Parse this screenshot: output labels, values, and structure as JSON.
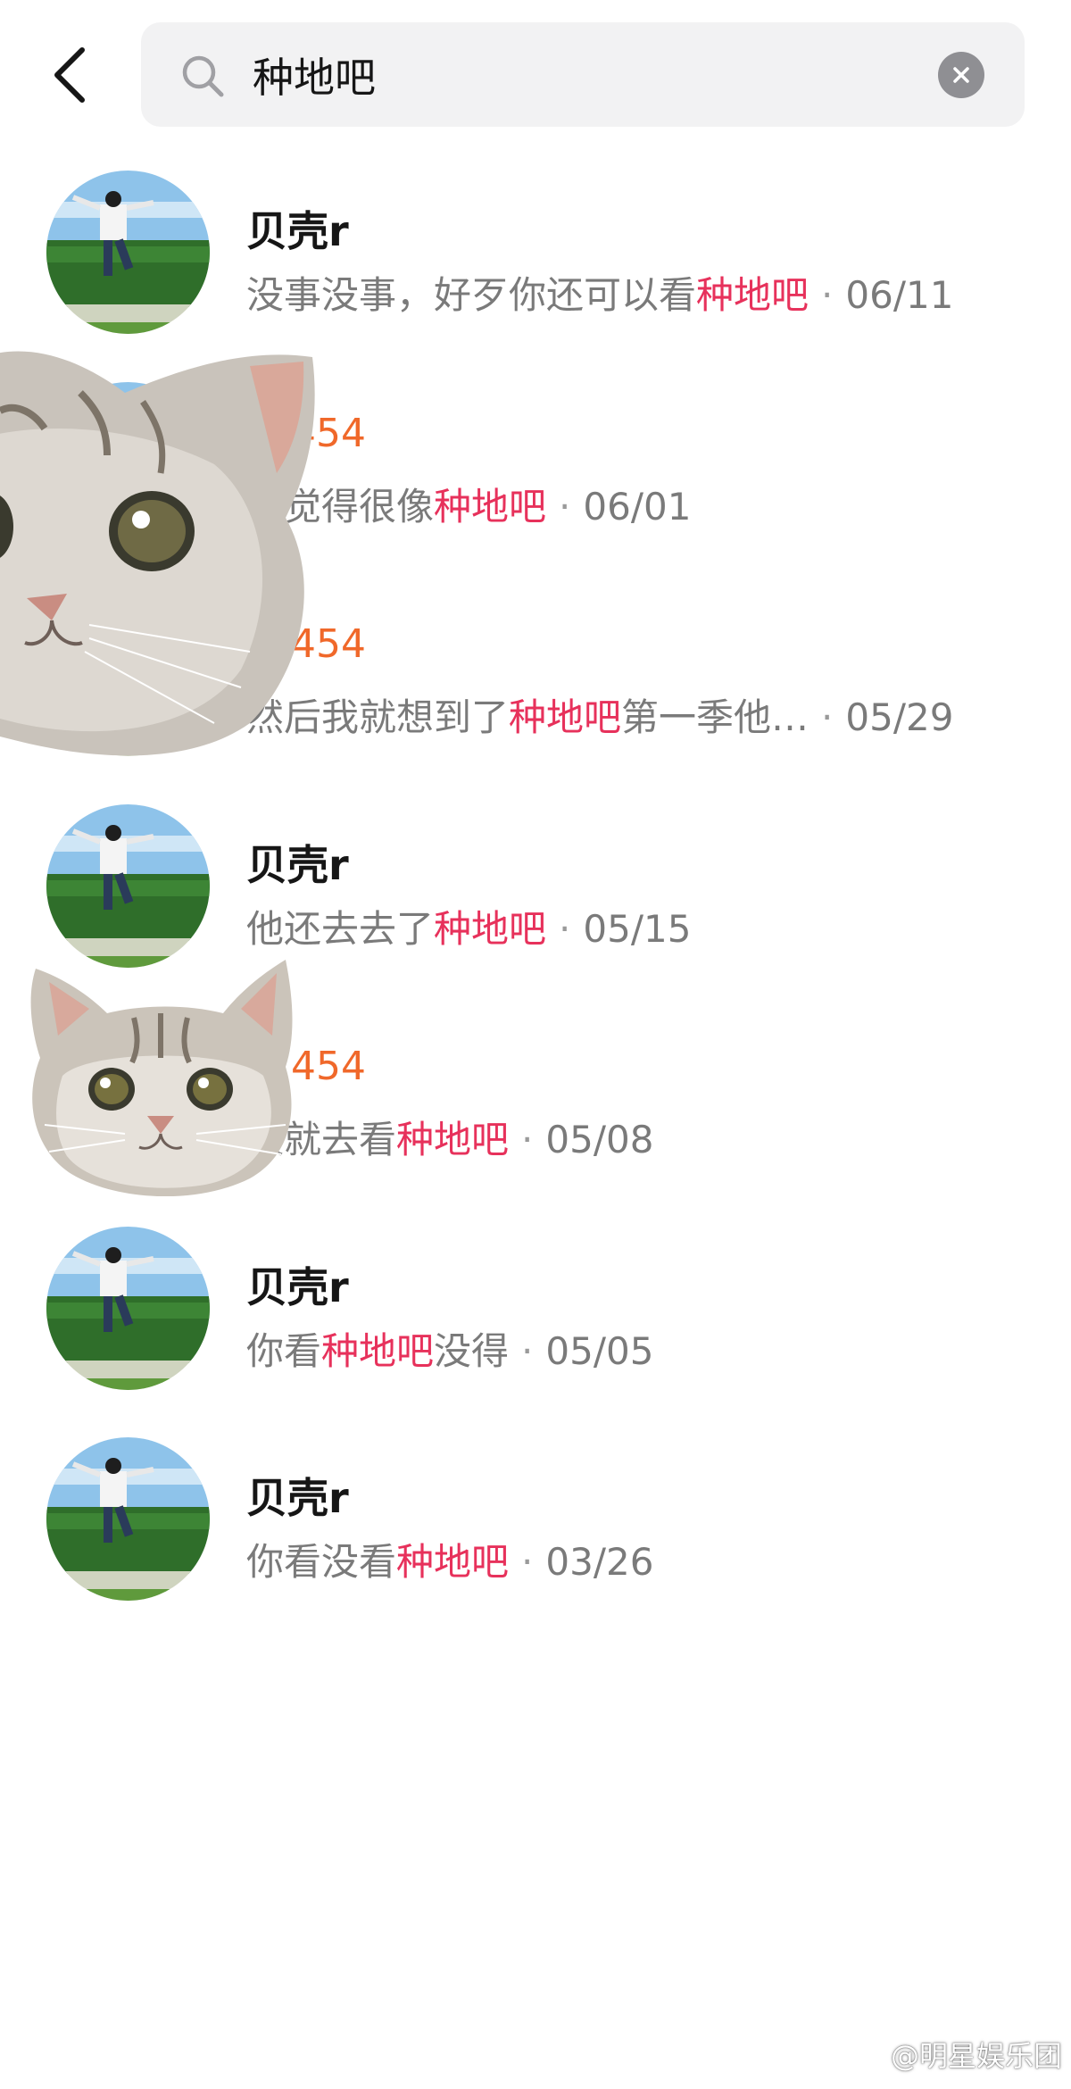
{
  "search": {
    "query": "种地吧"
  },
  "results": [
    {
      "name": "贝壳r",
      "heat": "",
      "pre": "没事没事，好歹你还可以看",
      "hl": "种地吧",
      "post": "",
      "date": "06/11"
    },
    {
      "name": "",
      "heat": "454",
      "pre": "不觉得很像",
      "hl": "种地吧",
      "post": "",
      "date": "06/01"
    },
    {
      "name": "",
      "heat": "454",
      "pre": "然后我就想到了",
      "hl": "种地吧",
      "post": "第一季他…",
      "date": "05/29"
    },
    {
      "name": "贝壳r",
      "heat": "",
      "pre": "他还去去了",
      "hl": "种地吧",
      "post": "",
      "date": "05/15"
    },
    {
      "name": "",
      "heat": "454",
      "pre": "天就去看",
      "hl": "种地吧",
      "post": "",
      "date": "05/08"
    },
    {
      "name": "贝壳r",
      "heat": "",
      "pre": "你看",
      "hl": "种地吧",
      "post": "没得",
      "date": "05/05"
    },
    {
      "name": "贝壳r",
      "heat": "",
      "pre": "你看没看",
      "hl": "种地吧",
      "post": "",
      "date": "03/26"
    }
  ],
  "separator": "·",
  "watermark": {
    "text": "@明星娱乐团"
  },
  "colors": {
    "highlight": "#e7315b",
    "heat": "#f0682a",
    "search_bg": "#f2f2f3",
    "clear_button": "#8f8f93"
  },
  "icons": [
    "back-arrow-icon",
    "search-icon",
    "clear-icon",
    "fire-icon",
    "weibo-logo"
  ]
}
